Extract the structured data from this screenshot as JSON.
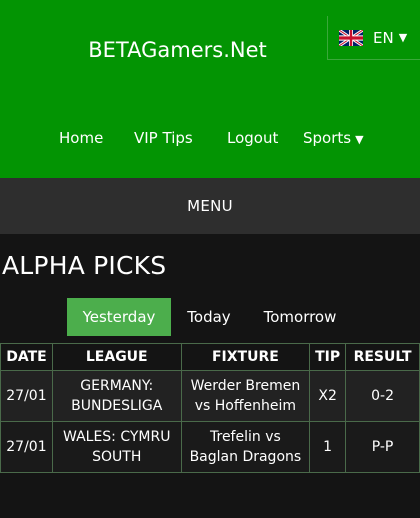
{
  "header": {
    "site_title": "BETAGamers.Net"
  },
  "lang": {
    "code": "EN",
    "flag_icon": "uk-flag-icon"
  },
  "nav": {
    "home": "Home",
    "vip": "VIP Tips",
    "logout": "Logout",
    "sports": "Sports"
  },
  "menu_label": "MENU",
  "page_title": "ALPHA PICKS",
  "tabs": [
    {
      "label": "Yesterday",
      "active": true
    },
    {
      "label": "Today",
      "active": false
    },
    {
      "label": "Tomorrow",
      "active": false
    }
  ],
  "table": {
    "headers": [
      "DATE",
      "LEAGUE",
      "FIXTURE",
      "TIP",
      "RESULT"
    ],
    "rows": [
      {
        "date": "27/01",
        "league": [
          "GERMANY:",
          "BUNDESLIGA"
        ],
        "fixture": [
          "Werder Bremen",
          "vs Hoffenheim"
        ],
        "tip": "X2",
        "result": "0-2"
      },
      {
        "date": "27/01",
        "league": [
          "WALES: CYMRU",
          "SOUTH"
        ],
        "fixture": [
          "Trefelin vs",
          "Baglan Dragons"
        ],
        "tip": "1",
        "result": "P-P"
      }
    ]
  },
  "colors": {
    "header_bg": "#039403",
    "active_tab": "#4cae4c",
    "menu_bg": "#2e2e2e",
    "page_bg": "#141414"
  }
}
